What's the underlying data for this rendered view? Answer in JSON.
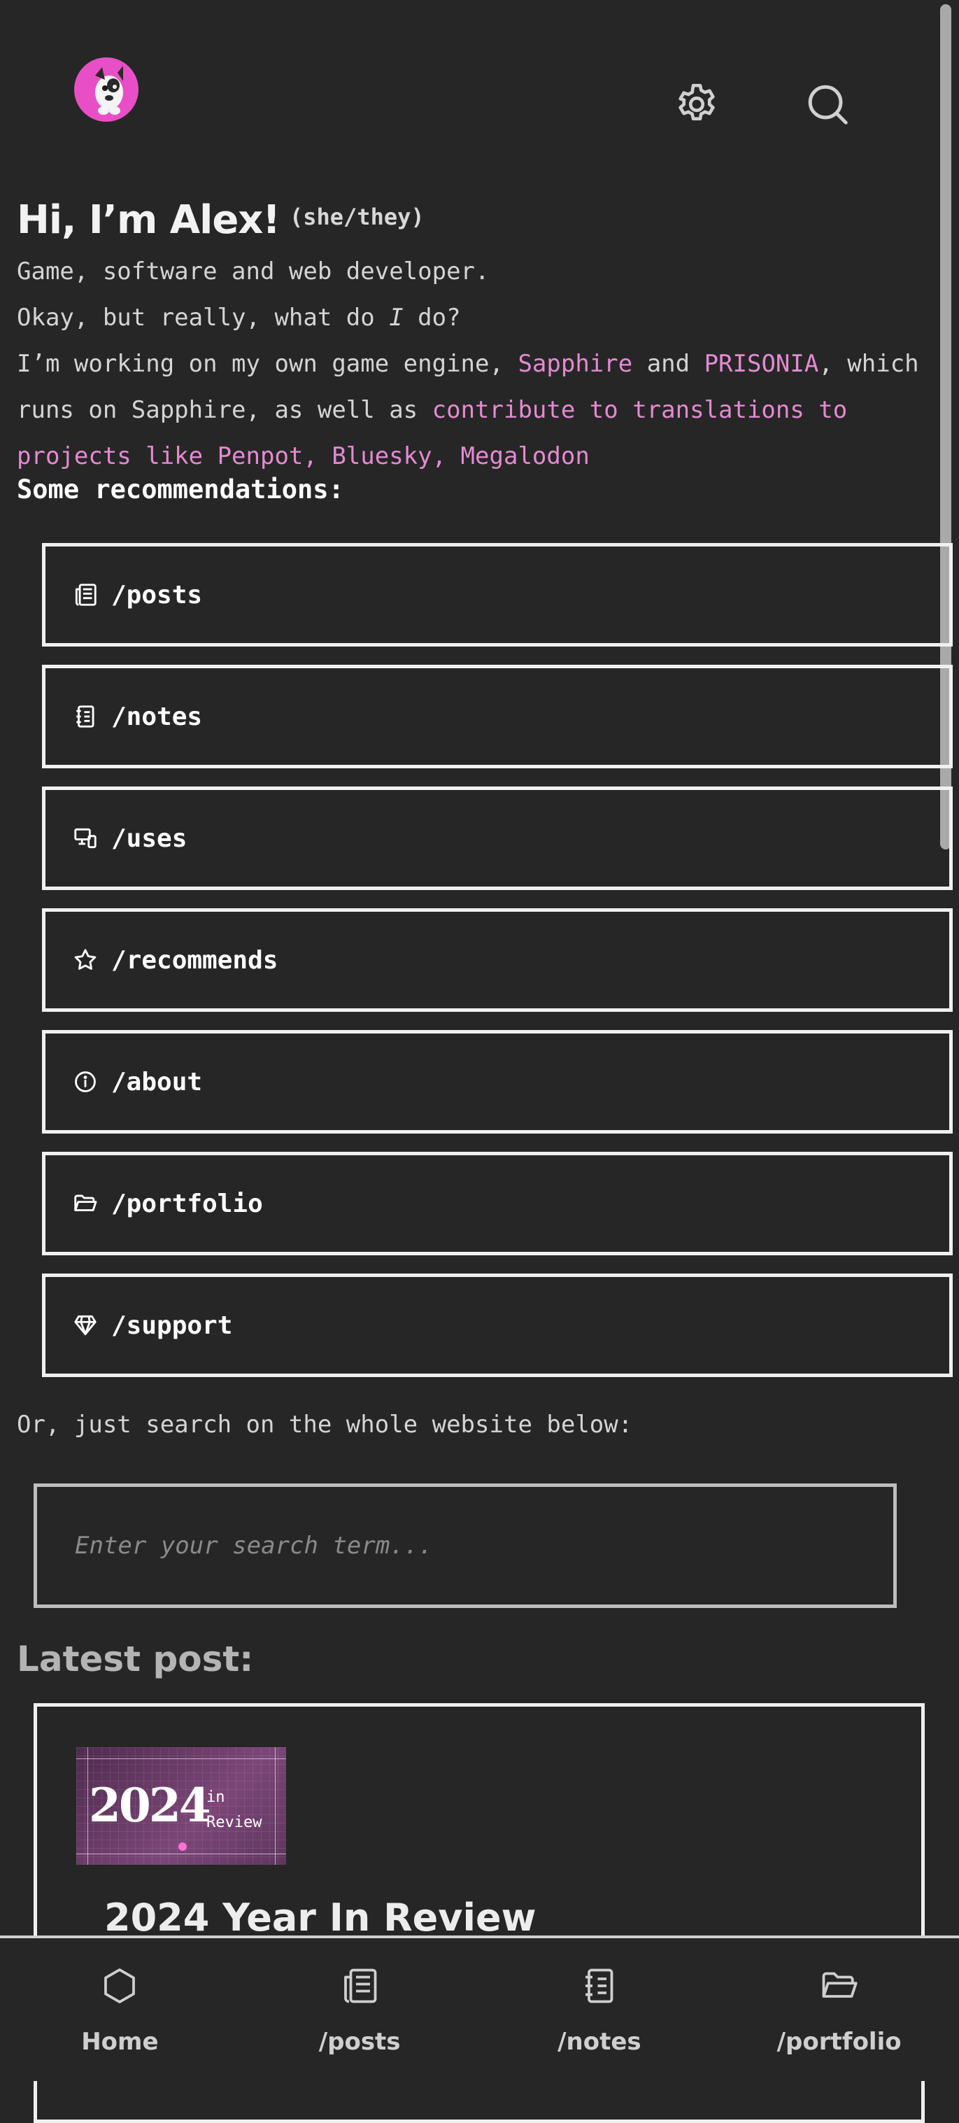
{
  "header": {
    "avatar": "avatar-dog-icon",
    "settings_icon": "gear-icon",
    "search_icon": "search-icon"
  },
  "hero": {
    "greeting": "Hi, I’m Alex!",
    "pronouns": "(she/they)",
    "tagline": "Game, software and web developer.",
    "question_before": "Okay, but really, what do ",
    "question_emph": "I",
    "question_after": " do?",
    "work_1": "I’m working on my own game engine, ",
    "link_sapphire": "Sapphire",
    "work_2": " and ",
    "link_prisonia": "PRISONIA",
    "work_3": ", which runs on Sapphire, as well as ",
    "link_translations": "contribute to translations to projects like Penpot, Bluesky, Megalodon"
  },
  "recommendations": {
    "title": "Some recommendations:",
    "items": [
      {
        "label": "/posts",
        "icon": "newspaper-icon"
      },
      {
        "label": "/notes",
        "icon": "notebook-icon"
      },
      {
        "label": "/uses",
        "icon": "devices-icon"
      },
      {
        "label": "/recommends",
        "icon": "star-icon"
      },
      {
        "label": "/about",
        "icon": "info-icon"
      },
      {
        "label": "/portfolio",
        "icon": "folder-icon"
      },
      {
        "label": "/support",
        "icon": "diamond-icon"
      }
    ]
  },
  "search": {
    "hint": "Or, just search on the whole website below:",
    "placeholder": "Enter your search term..."
  },
  "latest": {
    "title": "Latest post:",
    "thumb_year": "2024",
    "thumb_in": "in",
    "thumb_review": "Review",
    "post_title": "2024 Year In Review"
  },
  "bottom_nav": [
    {
      "label": "Home",
      "icon": "hexagon-icon"
    },
    {
      "label": "/posts",
      "icon": "newspaper-icon"
    },
    {
      "label": "/notes",
      "icon": "notebook-icon"
    },
    {
      "label": "/portfolio",
      "icon": "folder-icon"
    }
  ],
  "colors": {
    "background": "#262626",
    "accent_link": "#e48ad2",
    "border": "#f0f0f0"
  }
}
